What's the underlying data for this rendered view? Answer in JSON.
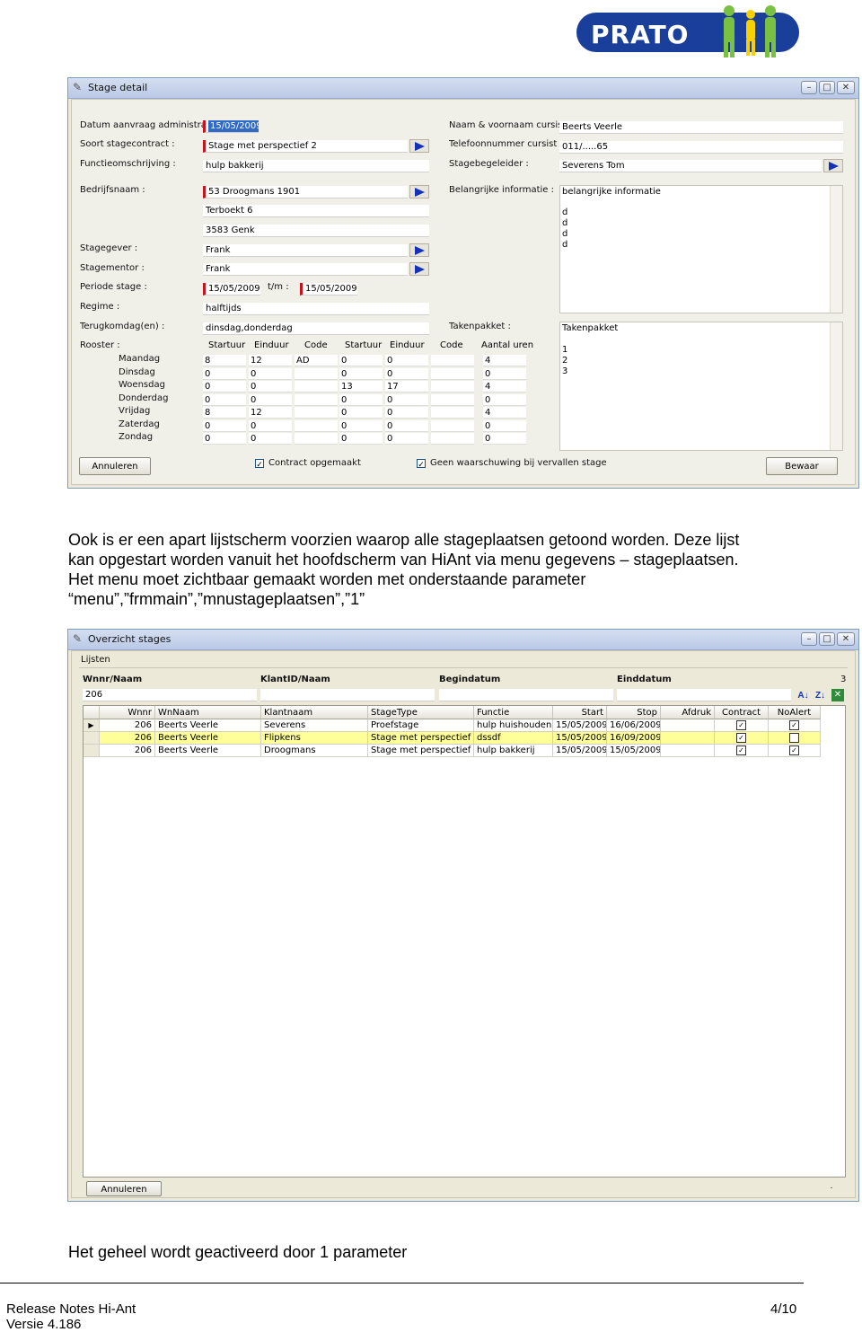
{
  "logo": {
    "text": "PRATO"
  },
  "stage_detail": {
    "title": "Stage detail",
    "labels": {
      "datum": "Datum aanvraag administratie :",
      "soort": "Soort stagecontract :",
      "functie": "Functieomschrijving :",
      "bedrijf": "Bedrijfsnaam :",
      "stagegever": "Stagegever :",
      "stagementor": "Stagementor :",
      "periode": "Periode stage :",
      "tm": "t/m :",
      "regime": "Regime :",
      "terugkom": "Terugkomdag(en) :",
      "rooster": "Rooster :",
      "naam": "Naam & voornaam cursist :",
      "telefoon": "Telefoonnummer cursist :",
      "begeleider": "Stagebegeleider :",
      "info": "Belangrijke informatie :",
      "takenpakket": "Takenpakket :"
    },
    "values": {
      "datum": "15/05/2009",
      "soort": "Stage met perspectief 2",
      "functie": "hulp bakkerij",
      "bedrijf": "53 Droogmans 1901",
      "adres1": "Terboekt 6",
      "adres2": "3583 Genk",
      "stagegever": "Frank",
      "stagementor": "Frank",
      "periode_van": "15/05/2009",
      "periode_tot": "15/05/2009",
      "regime": "halftijds",
      "terugkom": "dinsdag,donderdag",
      "naam": "Beerts Veerle",
      "telefoon": "011/.....65",
      "begeleider": "Severens Tom"
    },
    "info_lines": [
      "belangrijke informatie",
      "",
      "d",
      "d",
      "d",
      "d"
    ],
    "taken_lines": [
      "Takenpakket",
      "",
      "1",
      "2",
      "3"
    ],
    "schedule": {
      "headers": [
        "Startuur",
        "Einduur",
        "Code",
        "Startuur",
        "Einduur",
        "Code",
        "Aantal uren"
      ],
      "days": [
        "Maandag",
        "Dinsdag",
        "Woensdag",
        "Donderdag",
        "Vrijdag",
        "Zaterdag",
        "Zondag"
      ],
      "rows": [
        [
          "8",
          "12",
          "AD",
          "0",
          "0",
          "",
          "4"
        ],
        [
          "0",
          "0",
          "",
          "0",
          "0",
          "",
          "0"
        ],
        [
          "0",
          "0",
          "",
          "13",
          "17",
          "",
          "4"
        ],
        [
          "0",
          "0",
          "",
          "0",
          "0",
          "",
          "0"
        ],
        [
          "8",
          "12",
          "",
          "0",
          "0",
          "",
          "4"
        ],
        [
          "0",
          "0",
          "",
          "0",
          "0",
          "",
          "0"
        ],
        [
          "0",
          "0",
          "",
          "0",
          "0",
          "",
          "0"
        ]
      ]
    },
    "buttons": {
      "annuleren": "Annuleren",
      "bewaar": "Bewaar"
    },
    "checks": {
      "contract": "Contract opgemaakt",
      "geen_waarschuwing": "Geen waarschuwing bij vervallen stage"
    }
  },
  "paragraph_lines": [
    "Ook is er een apart lijstscherm voorzien waarop alle stageplaatsen getoond worden. Deze lijst",
    "kan opgestart worden vanuit het hoofdscherm van HiAnt via menu gegevens – stageplaatsen.",
    "Het menu moet zichtbaar gemaakt worden met onderstaande parameter",
    "“menu”,”frmmain”,”mnustageplaatsen”,”1”"
  ],
  "overzicht": {
    "title": "Overzicht stages",
    "tab": "Lijsten",
    "filters": {
      "labels": [
        "Wnnr/Naam",
        "KlantID/Naam",
        "Begindatum",
        "Einddatum"
      ],
      "values": [
        "206",
        "",
        "",
        ""
      ],
      "count": "3"
    },
    "columns": [
      "Wnnr",
      "WnNaam",
      "Klantnaam",
      "StageType",
      "Functie",
      "Start",
      "Stop",
      "Afdruk",
      "Contract",
      "NoAlert"
    ],
    "rows": [
      {
        "wnnr": "206",
        "wnnaam": "Beerts Veerle",
        "klant": "Severens",
        "type": "Proefstage",
        "functie": "hulp huishouden",
        "start": "15/05/2009",
        "stop": "16/06/2009",
        "afdruk": "",
        "contract": "✓",
        "noalert": "✓"
      },
      {
        "wnnr": "206",
        "wnnaam": "Beerts Veerle",
        "klant": "Flipkens",
        "type": "Stage met perspectief",
        "functie": "dssdf",
        "start": "15/05/2009",
        "stop": "16/09/2009",
        "afdruk": "",
        "contract": "✓",
        "noalert": ""
      },
      {
        "wnnr": "206",
        "wnnaam": "Beerts Veerle",
        "klant": "Droogmans",
        "type": "Stage met perspectief",
        "functie": "hulp bakkerij",
        "start": "15/05/2009",
        "stop": "15/05/2009",
        "afdruk": "",
        "contract": "✓",
        "noalert": "✓"
      }
    ],
    "annuleren": "Annuleren"
  },
  "closing_text": "Het geheel wordt geactiveerd door 1 parameter",
  "footer": {
    "left1": "Release Notes Hi-Ant",
    "left2": "Versie 4.186",
    "page": "4/10"
  },
  "colors": {
    "accent": "#316ac5",
    "required": "#c8121e",
    "row_highlight": "#ffff99",
    "logo": "#1a3f9a"
  }
}
